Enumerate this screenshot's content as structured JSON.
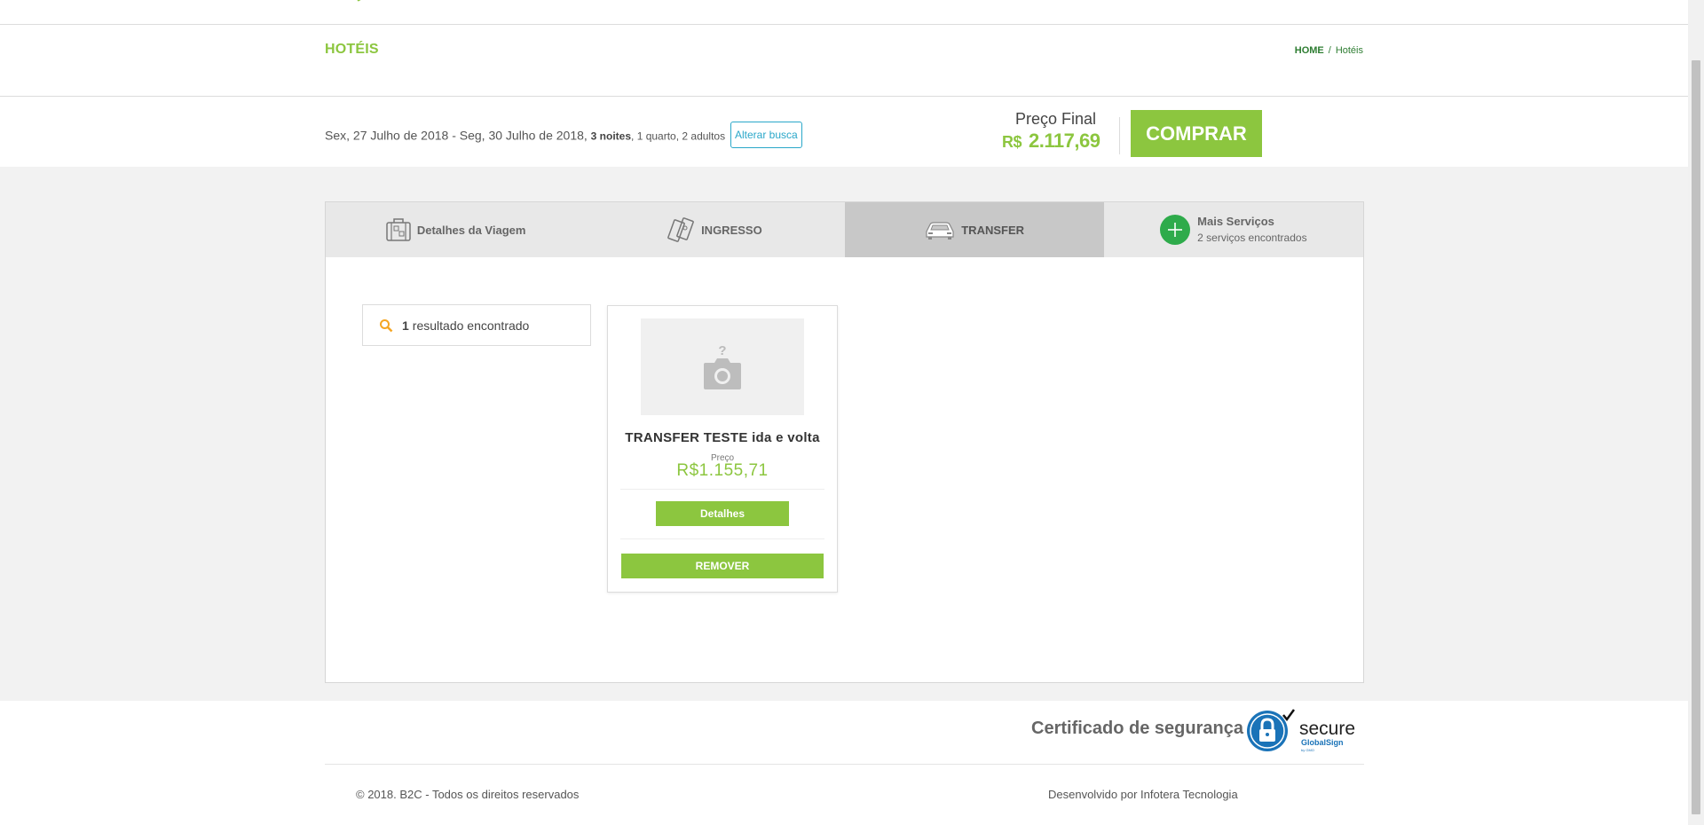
{
  "header": {
    "page_title": "HOTÉIS",
    "breadcrumb": {
      "home": "HOME",
      "separator": "/",
      "current": "Hotéis"
    }
  },
  "summary": {
    "dates": "Sex, 27 Julho de 2018 - Seg, 30 Julho de 2018,",
    "nights": "3 noites",
    "rooms_guests": ", 1 quarto, 2 adultos",
    "change_search": "Alterar busca",
    "final_price_label": "Preço Final",
    "currency": "R$",
    "final_price": "2.117,69",
    "buy_label": "COMPRAR"
  },
  "tabs": [
    {
      "label": "Detalhes da Viagem",
      "icon": "suitcase-icon"
    },
    {
      "label": "INGRESSO",
      "icon": "tickets-icon"
    },
    {
      "label": "TRANSFER",
      "icon": "car-icon",
      "active": true
    },
    {
      "label": "Mais Serviços",
      "sub": "2 serviços encontrados",
      "icon": "plus-circle-icon"
    }
  ],
  "results": {
    "count": "1",
    "text": "resultado encontrado"
  },
  "card": {
    "name": "TRANSFER TESTE ida e volta",
    "price_label": "Preço",
    "price": "R$1.155,71",
    "details_label": "Detalhes",
    "remove_label": "REMOVER"
  },
  "footer": {
    "certificate": "Certificado de segurança",
    "seal_text": "secure",
    "seal_brand": "GlobalSign",
    "seal_sub": "by GMO",
    "copyright": "© 2018. B2C - Todos os direitos reservados",
    "developer": "Desenvolvido por Infotera Tecnologia"
  },
  "colors": {
    "accent": "#8cc63f",
    "link": "#2aa7c9",
    "plus": "#2eab4b",
    "seal": "#1a73b8"
  }
}
